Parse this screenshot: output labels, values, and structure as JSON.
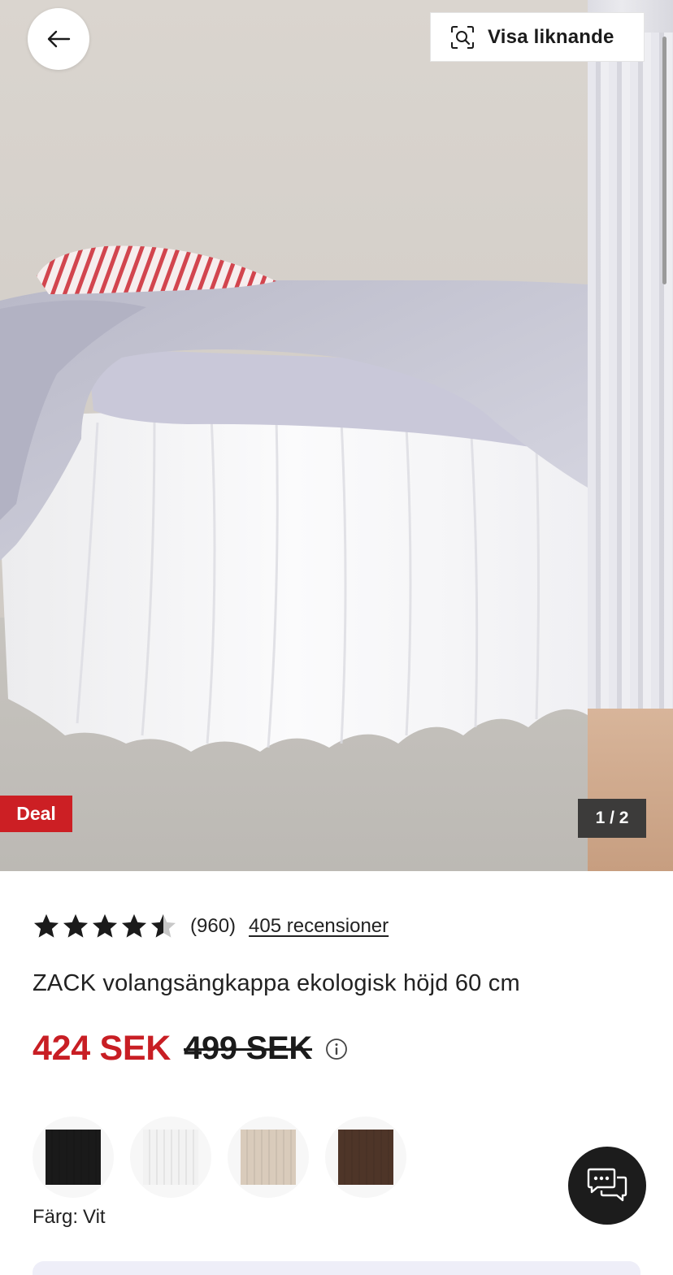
{
  "header": {
    "similar_label": "Visa liknande",
    "back_icon": "arrow-left-icon",
    "similar_icon": "visual-search-icon"
  },
  "gallery": {
    "badge": "Deal",
    "pager": "1 / 2",
    "current_image": 1,
    "image_count": 2
  },
  "rating": {
    "value": 4.5,
    "max": 5,
    "count": "(960)",
    "reviews_link": "405 recensioner"
  },
  "product": {
    "title": "ZACK volangsängkappa ekologisk höjd 60 cm"
  },
  "price": {
    "current": "424 SEK",
    "original": "499 SEK",
    "current_color": "#c81e24",
    "info_icon": "info-circle-icon"
  },
  "colors": {
    "label": "Färg:",
    "selected": "Vit",
    "options": [
      {
        "swatch": "#1a1a1a"
      },
      {
        "swatch": "#f2f2f2"
      },
      {
        "swatch": "#d9cbbb"
      },
      {
        "swatch": "#4e3528"
      }
    ]
  },
  "chat": {
    "icon": "chat-bubbles-icon"
  },
  "theme": {
    "deal_red": "#cc1f24",
    "price_red": "#c81e24",
    "chat_bg": "#1c1c1c"
  }
}
